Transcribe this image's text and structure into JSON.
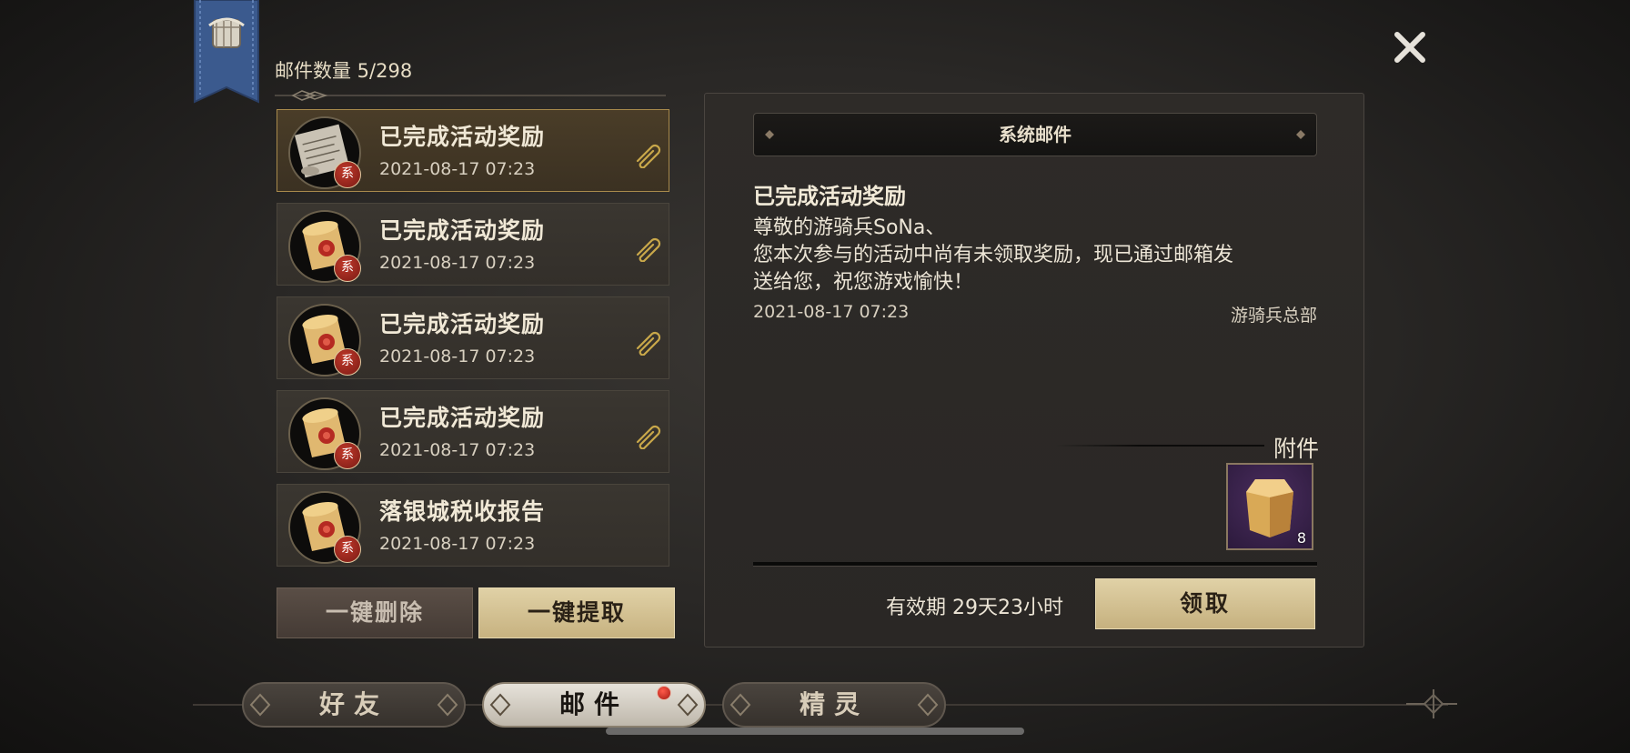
{
  "header": {
    "mail_count_label": "邮件数量 5/298"
  },
  "mail_list": [
    {
      "title": "已完成活动奖励",
      "date": "2021-08-17 07:23",
      "badge": "系",
      "has_attachment": true,
      "icon": "letter-scroll-icon",
      "selected": true
    },
    {
      "title": "已完成活动奖励",
      "date": "2021-08-17 07:23",
      "badge": "系",
      "has_attachment": true,
      "icon": "sealed-scroll-icon",
      "selected": false
    },
    {
      "title": "已完成活动奖励",
      "date": "2021-08-17 07:23",
      "badge": "系",
      "has_attachment": true,
      "icon": "sealed-scroll-icon",
      "selected": false
    },
    {
      "title": "已完成活动奖励",
      "date": "2021-08-17 07:23",
      "badge": "系",
      "has_attachment": true,
      "icon": "sealed-scroll-icon",
      "selected": false
    },
    {
      "title": "落银城税收报告",
      "date": "2021-08-17 07:23",
      "badge": "系",
      "has_attachment": false,
      "icon": "sealed-scroll-icon",
      "selected": false
    }
  ],
  "actions": {
    "delete_all": "一键删除",
    "claim_all": "一键提取"
  },
  "detail": {
    "category": "系统邮件",
    "title": "已完成活动奖励",
    "body_lines": [
      "尊敬的游骑兵SoNa、",
      "您本次参与的活动中尚有未领取奖励，现已通过邮箱发",
      "送给您，祝您游戏愉快！"
    ],
    "date": "2021-08-17 07:23",
    "sender": "游骑兵总部",
    "attachment_label": "附件",
    "attachment_item": {
      "icon": "gold-crystal-icon",
      "quantity": "8"
    },
    "validity": "有效期 29天23小时",
    "claim_button": "领取"
  },
  "tabs": [
    {
      "label": "好友",
      "active": false
    },
    {
      "label": "邮件",
      "active": true
    },
    {
      "label": "精灵",
      "active": false
    }
  ],
  "colors": {
    "accent_gold": "#c7b280",
    "selected_border": "#a88a4c",
    "badge_red": "#c0392b",
    "attachment_bg": "#2c1a3c"
  }
}
